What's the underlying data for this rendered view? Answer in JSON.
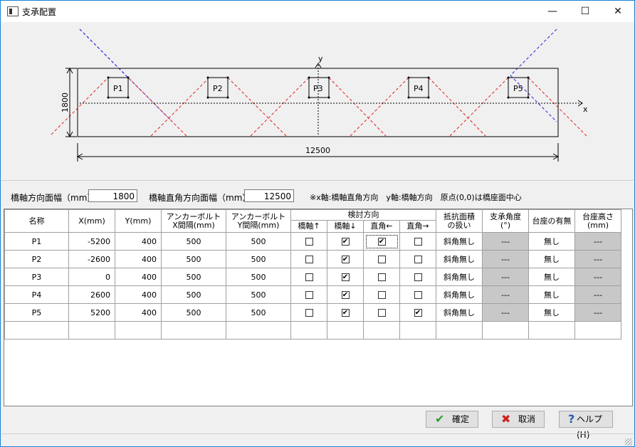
{
  "window": {
    "title": "支承配置",
    "minimize": "—",
    "maximize": "☐",
    "close": "✕"
  },
  "drawing": {
    "width_dim": "12500",
    "height_dim": "1800",
    "x_axis": "x",
    "y_axis": "y",
    "points": [
      "P1",
      "P2",
      "P3",
      "P4",
      "P5"
    ]
  },
  "dims": {
    "bridge_width_label": "橋軸方向面幅（mm）",
    "bridge_width_value": "1800",
    "cross_width_label": "橋軸直角方向面幅（mm）",
    "cross_width_value": "12500",
    "note": "※x軸:橋軸直角方向　y軸:橋軸方向　原点(0,0)は橋座面中心"
  },
  "grid": {
    "headers": {
      "name": "名称",
      "x": "X(mm)",
      "y": "Y(mm)",
      "anchor_x_1": "アンカーボルト",
      "anchor_x_2": "X間隔(mm)",
      "anchor_y_1": "アンカーボルト",
      "anchor_y_2": "Y間隔(mm)",
      "check_dir": "検討方向",
      "chk1": "橋軸↑",
      "chk2": "橋軸↓",
      "chk3": "直角←",
      "chk4": "直角→",
      "resist_1": "抵抗面積",
      "resist_2": "の扱い",
      "angle_1": "支承角度",
      "angle_2": "(°)",
      "pedestal": "台座の有無",
      "ped_h_1": "台座高さ",
      "ped_h_2": "(mm)"
    },
    "rows": [
      {
        "name": "P1",
        "x": "-5200",
        "y": "400",
        "ax": "500",
        "ay": "500",
        "c1": "",
        "c2": "✔",
        "c3": "✔",
        "c4": "",
        "resist": "斜角無し",
        "angle": "---",
        "ped": "無し",
        "ph": "---"
      },
      {
        "name": "P2",
        "x": "-2600",
        "y": "400",
        "ax": "500",
        "ay": "500",
        "c1": "",
        "c2": "✔",
        "c3": "",
        "c4": "",
        "resist": "斜角無し",
        "angle": "---",
        "ped": "無し",
        "ph": "---"
      },
      {
        "name": "P3",
        "x": "0",
        "y": "400",
        "ax": "500",
        "ay": "500",
        "c1": "",
        "c2": "✔",
        "c3": "",
        "c4": "",
        "resist": "斜角無し",
        "angle": "---",
        "ped": "無し",
        "ph": "---"
      },
      {
        "name": "P4",
        "x": "2600",
        "y": "400",
        "ax": "500",
        "ay": "500",
        "c1": "",
        "c2": "✔",
        "c3": "",
        "c4": "",
        "resist": "斜角無し",
        "angle": "---",
        "ped": "無し",
        "ph": "---"
      },
      {
        "name": "P5",
        "x": "5200",
        "y": "400",
        "ax": "500",
        "ay": "500",
        "c1": "",
        "c2": "✔",
        "c3": "",
        "c4": "✔",
        "resist": "斜角無し",
        "angle": "---",
        "ped": "無し",
        "ph": "---"
      }
    ]
  },
  "buttons": {
    "ok": "確定",
    "cancel": "取消",
    "help": "ヘルプ(H)"
  },
  "colors": {
    "accent": "#1883d7",
    "ok_icon": "#2e9e2e",
    "cancel_icon": "#cc2222",
    "help_icon": "#2a5db0"
  }
}
